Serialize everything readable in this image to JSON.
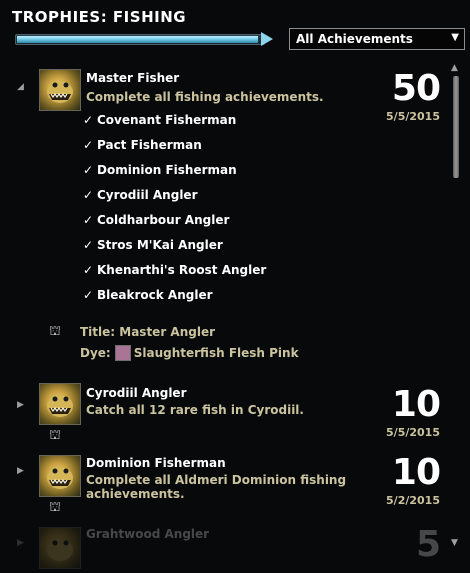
{
  "header": {
    "title": "TROPHIES: FISHING",
    "progress": 0.97,
    "filter_value": "All Achievements"
  },
  "entries": [
    {
      "name": "Master Fisher",
      "description": "Complete all fishing achievements.",
      "points": "50",
      "date": "5/5/2015",
      "expanded": true,
      "sub_items": [
        "Covenant Fisherman",
        "Pact Fisherman",
        "Dominion Fisherman",
        "Cyrodiil Angler",
        "Coldharbour Angler",
        "Stros M'Kai Angler",
        "Khenarthi's Roost Angler",
        "Bleakrock Angler"
      ],
      "rewards": {
        "title": "Title: Master Angler",
        "dye_label": "Dye:",
        "dye_name": "Slaughterfish Flesh Pink",
        "dye_color": "#a97495"
      }
    },
    {
      "name": "Cyrodiil Angler",
      "description": "Catch all 12 rare fish in Cyrodiil.",
      "points": "10",
      "date": "5/5/2015"
    },
    {
      "name": "Dominion Fisherman",
      "description": "Complete all Aldmeri Dominion fishing achievements.",
      "points": "10",
      "date": "5/2/2015"
    },
    {
      "name": "Grahtwood Angler",
      "points": "5"
    }
  ],
  "icons": {
    "check": "✓",
    "expand_open": "◢",
    "expand_closed": "▶",
    "dropdown_arrow": "▼",
    "reward": "⛫"
  }
}
